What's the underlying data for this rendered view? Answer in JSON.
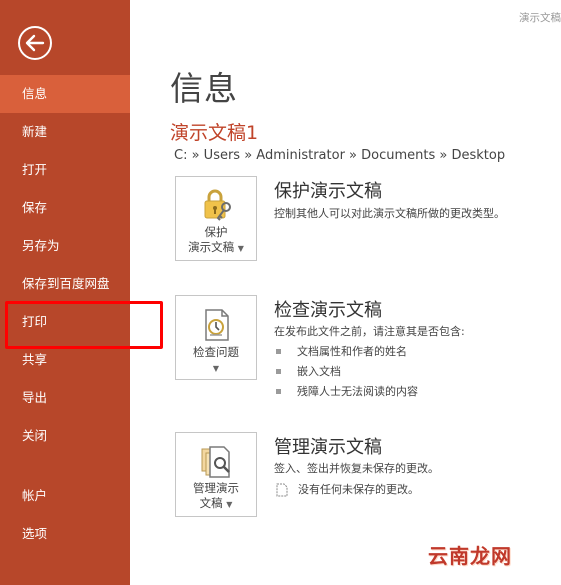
{
  "window": {
    "title": "演示文稿"
  },
  "sidebar": {
    "items": [
      {
        "label": "信息",
        "active": true
      },
      {
        "label": "新建"
      },
      {
        "label": "打开"
      },
      {
        "label": "保存"
      },
      {
        "label": "另存为"
      },
      {
        "label": "保存到百度网盘"
      },
      {
        "label": "打印"
      },
      {
        "label": "共享"
      },
      {
        "label": "导出"
      },
      {
        "label": "关闭"
      }
    ],
    "bottom_items": [
      {
        "label": "帐户"
      },
      {
        "label": "选项"
      }
    ]
  },
  "main": {
    "title": "信息",
    "doc_name": "演示文稿1",
    "path": "C: » Users » Administrator » Documents » Desktop",
    "sections": [
      {
        "button_line1": "保护",
        "button_line2": "演示文稿",
        "title": "保护演示文稿",
        "desc": "控制其他人可以对此演示文稿所做的更改类型。"
      },
      {
        "button_line1": "检查问题",
        "title": "检查演示文稿",
        "desc": "在发布此文件之前，请注意其是否包含:",
        "bullets": [
          "文档属性和作者的姓名",
          "嵌入文档",
          "残障人士无法阅读的内容"
        ]
      },
      {
        "button_line1": "管理演示",
        "button_line2": "文稿",
        "title": "管理演示文稿",
        "desc": "签入、签出并恢复未保存的更改。",
        "note": "没有任何未保存的更改。"
      }
    ]
  },
  "watermark": "云南龙网",
  "colors": {
    "sidebar": "#b7472a",
    "active": "#d9603b",
    "accent": "#c0442a",
    "highlight": "#ff0000"
  },
  "icons": [
    "back-arrow-icon",
    "lock-key-icon",
    "inspect-document-icon",
    "manage-versions-icon",
    "document-icon"
  ]
}
